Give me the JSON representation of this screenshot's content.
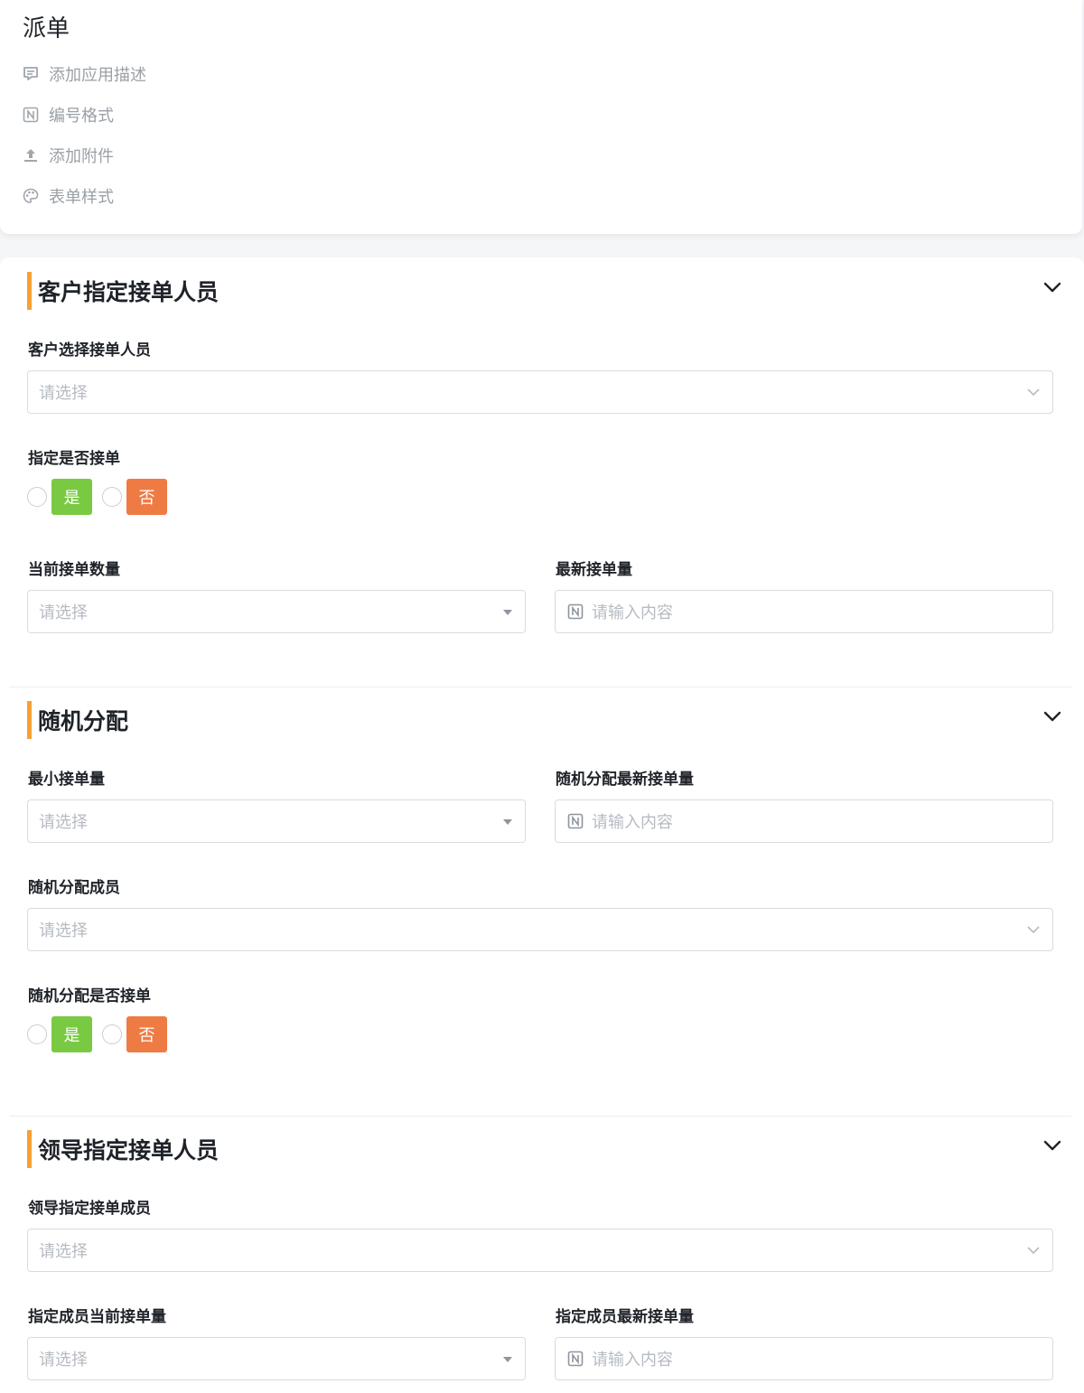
{
  "app": {
    "title": "派单",
    "actions": [
      {
        "label": "添加应用描述",
        "icon": "description-icon"
      },
      {
        "label": "编号格式",
        "icon": "number-format-icon"
      },
      {
        "label": "添加附件",
        "icon": "upload-icon"
      },
      {
        "label": "表单样式",
        "icon": "palette-icon"
      }
    ]
  },
  "sections": [
    {
      "title": "客户指定接单人员",
      "fields": {
        "customer_select_label": "客户选择接单人员",
        "customer_select_placeholder": "请选择",
        "assign_accept_label": "指定是否接单",
        "current_count_label": "当前接单数量",
        "current_count_placeholder": "请选择",
        "latest_count_label": "最新接单量",
        "latest_count_placeholder": "请输入内容"
      }
    },
    {
      "title": "随机分配",
      "fields": {
        "min_count_label": "最小接单量",
        "min_count_placeholder": "请选择",
        "random_latest_label": "随机分配最新接单量",
        "random_latest_placeholder": "请输入内容",
        "random_members_label": "随机分配成员",
        "random_members_placeholder": "请选择",
        "random_accept_label": "随机分配是否接单"
      }
    },
    {
      "title": "领导指定接单人员",
      "fields": {
        "leader_members_label": "领导指定接单成员",
        "leader_members_placeholder": "请选择",
        "member_current_label": "指定成员当前接单量",
        "member_current_placeholder": "请选择",
        "member_latest_label": "指定成员最新接单量",
        "member_latest_placeholder": "请输入内容"
      }
    }
  ],
  "radio_options": {
    "yes": "是",
    "no": "否"
  },
  "colors": {
    "accent_bar": "#f7a034",
    "yes": "#7ac943",
    "no": "#ef7b44"
  }
}
